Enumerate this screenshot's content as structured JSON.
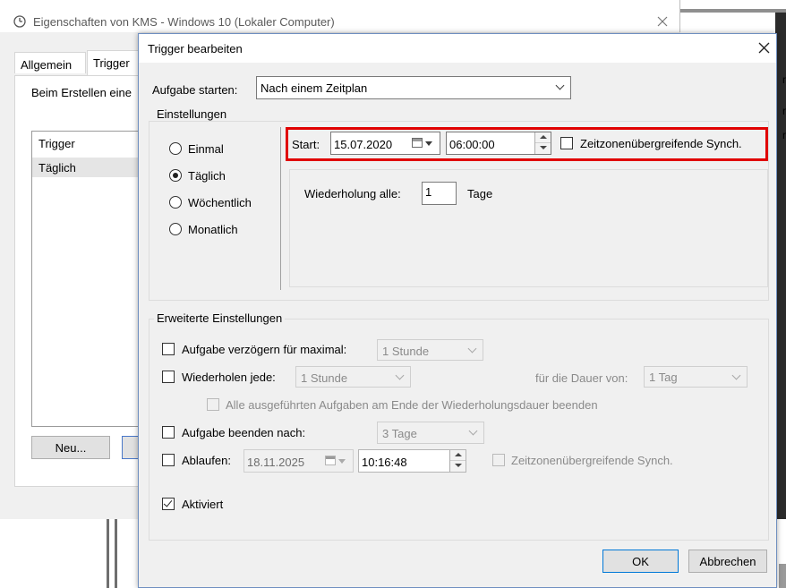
{
  "background_window": {
    "title": "Eigenschaften von KMS - Windows 10 (Lokaler Computer)",
    "tabs": [
      "Allgemein",
      "Trigger"
    ],
    "description": "Beim Erstellen eine",
    "list_header": "Trigger",
    "list_item": "Täglich",
    "new_button": "Neu..."
  },
  "dialog": {
    "title": "Trigger bearbeiten",
    "start_task_label": "Aufgabe starten:",
    "start_task_value": "Nach einem Zeitplan",
    "settings_legend": "Einstellungen",
    "schedule_options": [
      "Einmal",
      "Täglich",
      "Wöchentlich",
      "Monatlich"
    ],
    "selected_schedule": "Täglich",
    "start_label": "Start:",
    "start_date": "15.07.2020",
    "start_time": "06:00:00",
    "tz_sync_label": "Zeitzonenübergreifende Synch.",
    "repeat_every_label": "Wiederholung alle:",
    "repeat_every_value": "1",
    "repeat_every_unit": "Tage",
    "advanced_legend": "Erweiterte Einstellungen",
    "delay_label": "Aufgabe verzögern für maximal:",
    "delay_value": "1 Stunde",
    "repeat_label": "Wiederholen jede:",
    "repeat_value": "1 Stunde",
    "duration_label": "für die Dauer von:",
    "duration_value": "1 Tag",
    "stop_all_label": "Alle ausgeführten Aufgaben am Ende der Wiederholungsdauer beenden",
    "stop_after_label": "Aufgabe beenden nach:",
    "stop_after_value": "3 Tage",
    "expire_label": "Ablaufen:",
    "expire_date": "18.11.2025",
    "expire_time": "10:16:48",
    "expire_tz_label": "Zeitzonenübergreifende Synch.",
    "enabled_label": "Aktiviert",
    "ok_button": "OK",
    "cancel_button": "Abbrechen"
  },
  "highlight_color": "#e00000",
  "accent_color": "#0078d7"
}
